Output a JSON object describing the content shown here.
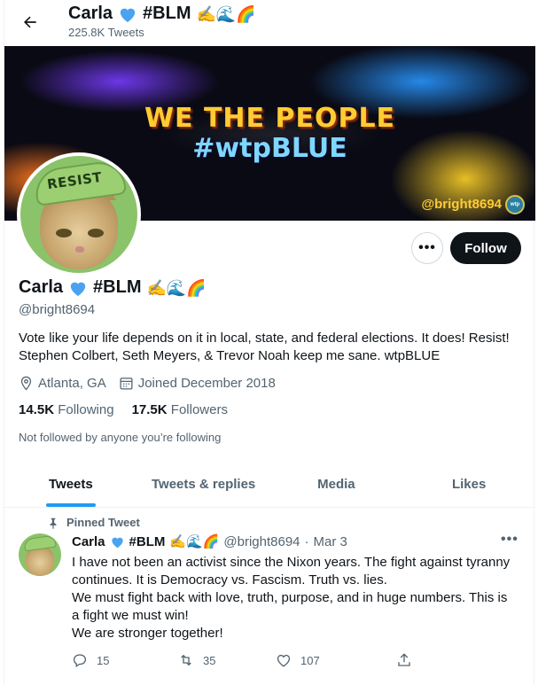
{
  "header": {
    "name": "Carla",
    "hashtag": "#BLM",
    "emoji": "✍🌊🌈",
    "tweet_count": "225.8K Tweets"
  },
  "banner": {
    "line1": "WE THE PEOPLE",
    "line2": "#wtpBLUE",
    "handle": "@bright8694",
    "badge_text": "wtp"
  },
  "avatar": {
    "hat_text": "RESIST"
  },
  "profile": {
    "name": "Carla",
    "hashtag": "#BLM",
    "emoji": "✍🌊🌈",
    "handle": "@bright8694",
    "bio_line1": "Vote like your life depends on it in local, state, and federal elections. It does! Resist!",
    "bio_line2": "Stephen Colbert, Seth Meyers, & Trevor Noah keep me sane. wtpBLUE",
    "location": "Atlanta, GA",
    "joined": "Joined December 2018",
    "following_count": "14.5K",
    "following_label": "Following",
    "followers_count": "17.5K",
    "followers_label": "Followers",
    "note": "Not followed by anyone you’re following",
    "follow_label": "Follow",
    "more_label": "•••"
  },
  "tabs": [
    {
      "label": "Tweets"
    },
    {
      "label": "Tweets & replies"
    },
    {
      "label": "Media"
    },
    {
      "label": "Likes"
    }
  ],
  "tweet": {
    "pinned_label": "Pinned Tweet",
    "name": "Carla",
    "hashtag": "#BLM",
    "emoji": "✍🌊🌈",
    "handle": "@bright8694",
    "sep": "·",
    "date": "Mar 3",
    "more": "•••",
    "line1": "I have not been an activist since the Nixon years. The fight against tyranny",
    "line2": "continues. It is Democracy vs. Fascism. Truth vs. lies.",
    "line3": "We must fight back with love, truth, purpose, and in huge numbers. This is",
    "line4": "a fight we must win!",
    "line5": "We are stronger together!",
    "replies": "15",
    "retweets": "35",
    "likes": "107"
  },
  "colors": {
    "accent": "#1d9bf0",
    "heart": "#4aa3f0",
    "text": "#0f1419",
    "secondary": "#536471"
  }
}
